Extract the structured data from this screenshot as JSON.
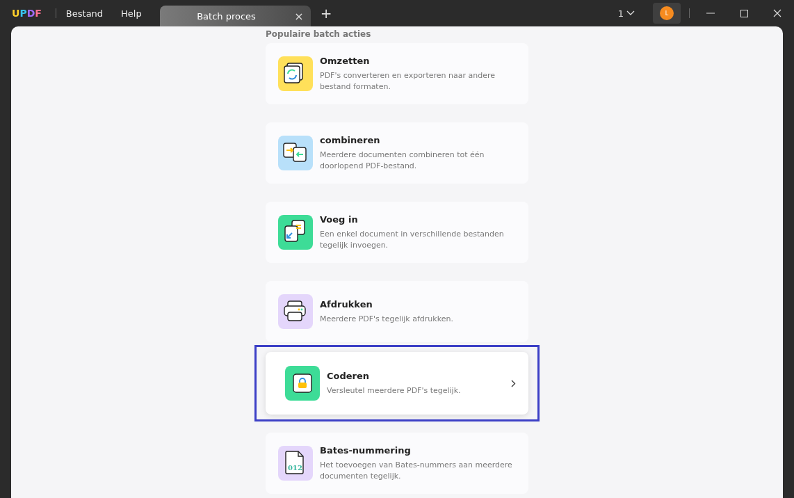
{
  "app": {
    "logo": "UPDF",
    "menu": [
      "Bestand",
      "Help"
    ]
  },
  "tabs": [
    {
      "label": "Batch proces",
      "selected": true,
      "close": "×"
    }
  ],
  "new_tab": "+",
  "page_count": "1",
  "avatar": {
    "initial": "L"
  },
  "section": {
    "heading": "Populaire batch acties"
  },
  "actions": [
    {
      "kind": "convert",
      "title": "Omzetten",
      "description": "PDF's converteren en exporteren naar andere bestand formaten.",
      "color": "#ffe05a",
      "highlighted": false
    },
    {
      "kind": "combine",
      "title": "combineren",
      "description": "Meerdere documenten combineren tot één doorlopend PDF-bestand.",
      "color": "#b8e0fa",
      "highlighted": false
    },
    {
      "kind": "insert",
      "title": "Voeg in",
      "description": "Een enkel document in verschillende bestanden tegelijk invoegen.",
      "color": "#3ddc97",
      "highlighted": false
    },
    {
      "kind": "print",
      "title": "Afdrukken",
      "description": "Meerdere PDF's tegelijk afdrukken.",
      "color": "#e4d6fb",
      "highlighted": false
    },
    {
      "kind": "encrypt",
      "title": "Coderen",
      "description": "Versleutel meerdere PDF's tegelijk.",
      "color": "#3ddc97",
      "highlighted": true
    },
    {
      "kind": "bates",
      "title": "Bates-nummering",
      "description": "Het toevoegen van Bates-nummers aan meerdere documenten tegelijk.",
      "color": "#e4d6fb",
      "highlighted": false,
      "icon_text": "012"
    }
  ]
}
